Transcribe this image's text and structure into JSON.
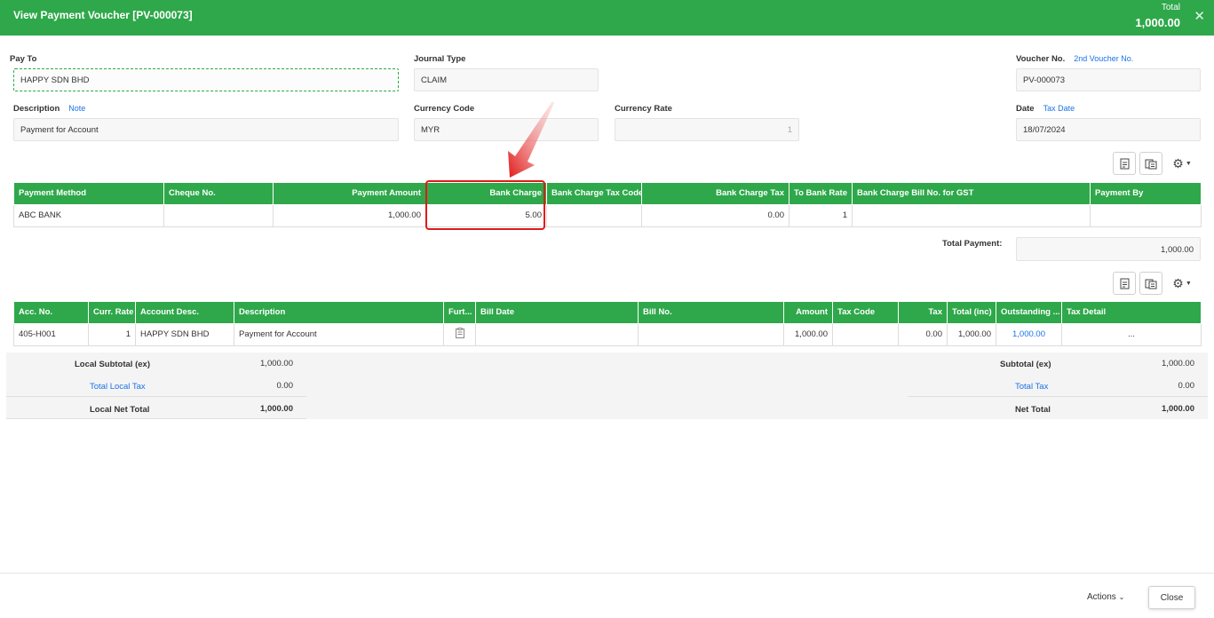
{
  "header": {
    "title": "View Payment Voucher [PV-000073]",
    "total_label": "Total",
    "total_value": "1,000.00",
    "close_icon": "close-icon"
  },
  "form": {
    "pay_to": {
      "label": "Pay To",
      "value": "HAPPY SDN BHD"
    },
    "journal_type": {
      "label": "Journal Type",
      "value": "CLAIM"
    },
    "voucher_no": {
      "label": "Voucher No.",
      "link": "2nd Voucher No.",
      "value": "PV-000073"
    },
    "description": {
      "label": "Description",
      "link": "Note",
      "value": "Payment for Account"
    },
    "currency_code": {
      "label": "Currency Code",
      "value": "MYR"
    },
    "currency_rate": {
      "label": "Currency Rate",
      "value": "1"
    },
    "date": {
      "label": "Date",
      "link": "Tax Date",
      "value": "18/07/2024"
    }
  },
  "payment_table": {
    "headers": [
      "Payment Method",
      "Cheque No.",
      "Payment Amount",
      "Bank Charge",
      "Bank Charge Tax Code",
      "Bank Charge Tax",
      "To Bank Rate",
      "Bank Charge Bill No. for GST",
      "Payment By"
    ],
    "row": [
      "ABC BANK",
      "",
      "1,000.00",
      "5.00",
      "",
      "0.00",
      "1",
      "",
      ""
    ]
  },
  "total_payment": {
    "label": "Total Payment:",
    "value": "1,000.00"
  },
  "detail_table": {
    "headers": [
      "Acc. No.",
      "Curr. Rate",
      "Account Desc.",
      "Description",
      "Furt...",
      "Bill Date",
      "Bill No.",
      "Amount",
      "Tax Code",
      "Tax",
      "Total (inc)",
      "Outstanding ...",
      "Tax Detail"
    ],
    "row": [
      "405-H001",
      "1",
      "HAPPY SDN BHD",
      "Payment for Account",
      "",
      "",
      "",
      "1,000.00",
      "",
      "0.00",
      "1,000.00",
      "1,000.00",
      "..."
    ]
  },
  "local_totals": {
    "subtotal_label": "Local Subtotal (ex)",
    "subtotal_value": "1,000.00",
    "tax_label": "Total Local Tax",
    "tax_value": "0.00",
    "net_label": "Local Net Total",
    "net_value": "1,000.00"
  },
  "totals": {
    "subtotal_label": "Subtotal (ex)",
    "subtotal_value": "1,000.00",
    "tax_label": "Total Tax",
    "tax_value": "0.00",
    "net_label": "Net Total",
    "net_value": "1,000.00"
  },
  "footer": {
    "actions_label": "Actions",
    "close_label": "Close"
  },
  "colors": {
    "header_green": "#2ea84a",
    "link_blue": "#1a73e8",
    "highlight_red": "#e01919"
  },
  "icons": [
    "export-icon",
    "copy-icon",
    "gear-icon",
    "clipboard-icon",
    "chevron-down-icon",
    "arrow-annotation"
  ]
}
